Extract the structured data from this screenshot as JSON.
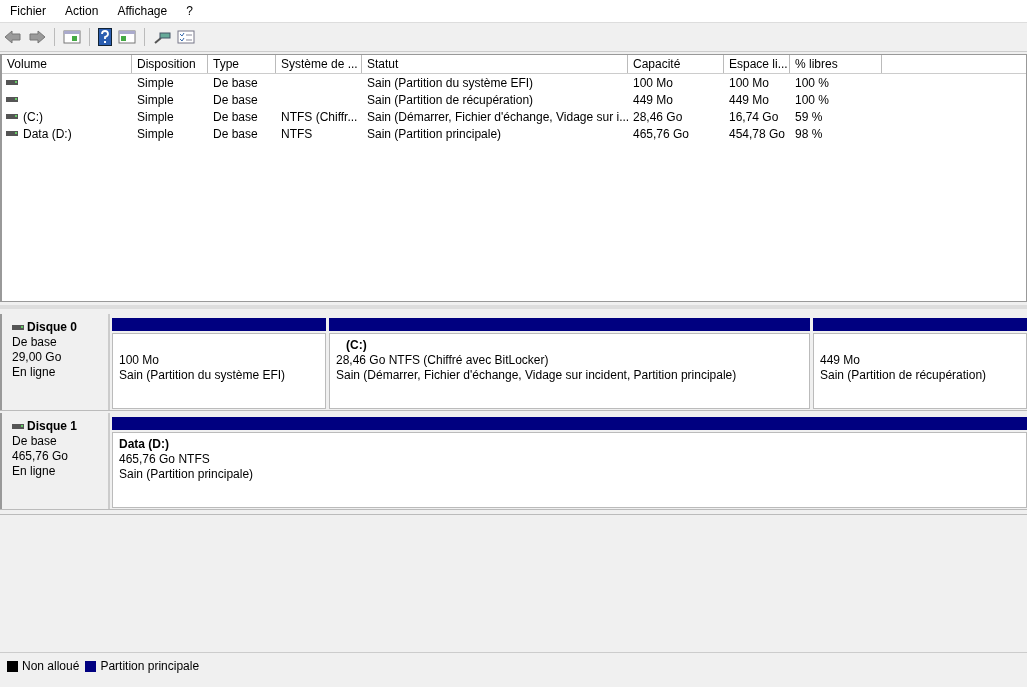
{
  "menu": [
    "Fichier",
    "Action",
    "Affichage",
    "?"
  ],
  "table": {
    "columns": [
      "Volume",
      "Disposition",
      "Type",
      "Système de ...",
      "Statut",
      "Capacité",
      "Espace li...",
      "% libres"
    ],
    "rows": [
      {
        "cells": [
          null,
          "Simple",
          "De base",
          null,
          "Sain (Partition du système EFI)",
          "100 Mo",
          "100 Mo",
          "100 %"
        ]
      },
      {
        "cells": [
          null,
          "Simple",
          "De base",
          null,
          "Sain (Partition de récupération)",
          "449 Mo",
          "449 Mo",
          "100 %"
        ]
      },
      {
        "cells": [
          "(C:)",
          "Simple",
          "De base",
          "NTFS (Chiffr...",
          "Sain (Démarrer, Fichier d'échange, Vidage sur i...",
          "28,46 Go",
          "16,74 Go",
          "59 %"
        ]
      },
      {
        "cells": [
          "Data (D:)",
          "Simple",
          "De base",
          "NTFS",
          "Sain (Partition principale)",
          "465,76 Go",
          "454,78 Go",
          "98 %"
        ]
      }
    ]
  },
  "disks": [
    {
      "name": "Disque 0",
      "type": "De base",
      "size": "29,00 Go",
      "state": "En ligne",
      "partitions": [
        {
          "size": "100 Mo",
          "status": "Sain (Partition du système EFI)",
          "color": "#000080"
        },
        {
          "label": "(C:)",
          "size": "28,46 Go NTFS (Chiffré avec BitLocker)",
          "status": "Sain (Démarrer, Fichier d'échange, Vidage sur incident, Partition principale)",
          "color": "#000080"
        },
        {
          "size": "449 Mo",
          "status": "Sain (Partition de récupération)",
          "color": "#000080"
        }
      ]
    },
    {
      "name": "Disque 1",
      "type": "De base",
      "size": "465,76 Go",
      "state": "En ligne",
      "partitions": [
        {
          "label": "Data  (D:)",
          "size": "465,76 Go NTFS",
          "status": "Sain (Partition principale)",
          "color": "#000080"
        }
      ]
    }
  ],
  "legend": [
    {
      "label": "Non alloué",
      "color": "#000000"
    },
    {
      "label": "Partition principale",
      "color": "#000080"
    }
  ]
}
